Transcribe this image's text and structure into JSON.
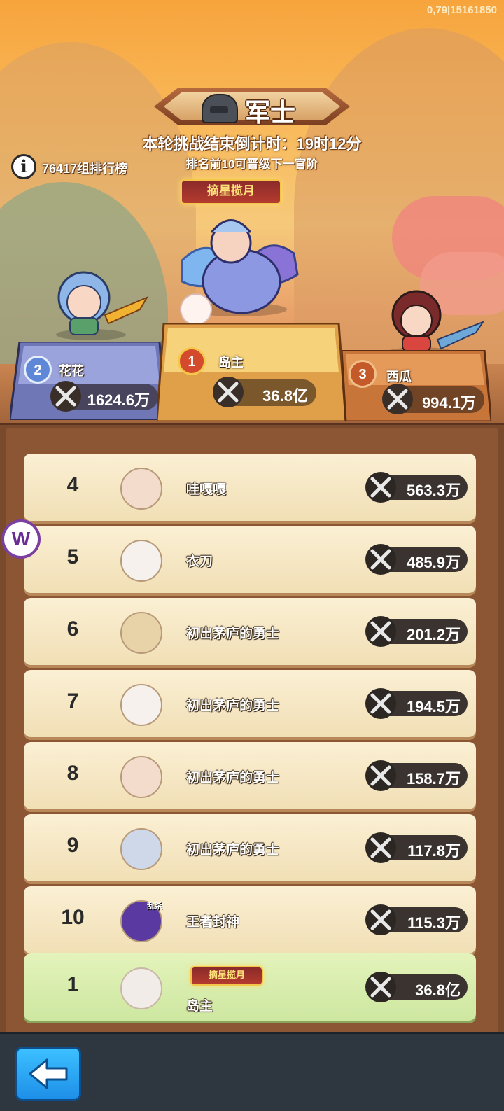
{
  "status": {
    "version_info": "0,79|15161850"
  },
  "header": {
    "rank_title": "军士",
    "countdown": "本轮挑战结束倒计时：19时12分",
    "promotion_note": "排名前10可晋级下一官阶",
    "group_leaderboard": "76417组排行榜",
    "info_icon": "info-icon"
  },
  "top3": {
    "first": {
      "rank": "1",
      "name": "岛主",
      "power": "36.8亿",
      "title_badge": "摘星揽月"
    },
    "second": {
      "rank": "2",
      "name": "花花",
      "power": "1624.6万"
    },
    "third": {
      "rank": "3",
      "name": "西瓜",
      "power": "994.1万"
    }
  },
  "leaderboard": [
    {
      "rank": "4",
      "name": "哇嘎嘎",
      "power": "563.3万"
    },
    {
      "rank": "5",
      "name": "衣刀",
      "power": "485.9万"
    },
    {
      "rank": "6",
      "name": "初出茅庐的勇士",
      "power": "201.2万"
    },
    {
      "rank": "7",
      "name": "初出茅庐的勇士",
      "power": "194.5万"
    },
    {
      "rank": "8",
      "name": "初出茅庐的勇士",
      "power": "158.7万"
    },
    {
      "rank": "9",
      "name": "初出茅庐的勇士",
      "power": "117.8万"
    },
    {
      "rank": "10",
      "name": "王者封神",
      "power": "115.3万",
      "avatar_tag": "乱杀"
    }
  ],
  "my_entry": {
    "rank": "1",
    "name": "岛主",
    "power": "36.8亿",
    "title_badge": "摘星揽月"
  },
  "colors": {
    "board": "#8c5634",
    "row": "#f4e4bd",
    "my_row": "#d6ecaa",
    "back_button": "#2aa7f5"
  },
  "icons": {
    "power": "crossed-swords-icon",
    "back": "back-arrow-icon",
    "helmet": "helmet-icon",
    "floating_logo": "w-logo-icon"
  },
  "floating_logo_text": "W"
}
